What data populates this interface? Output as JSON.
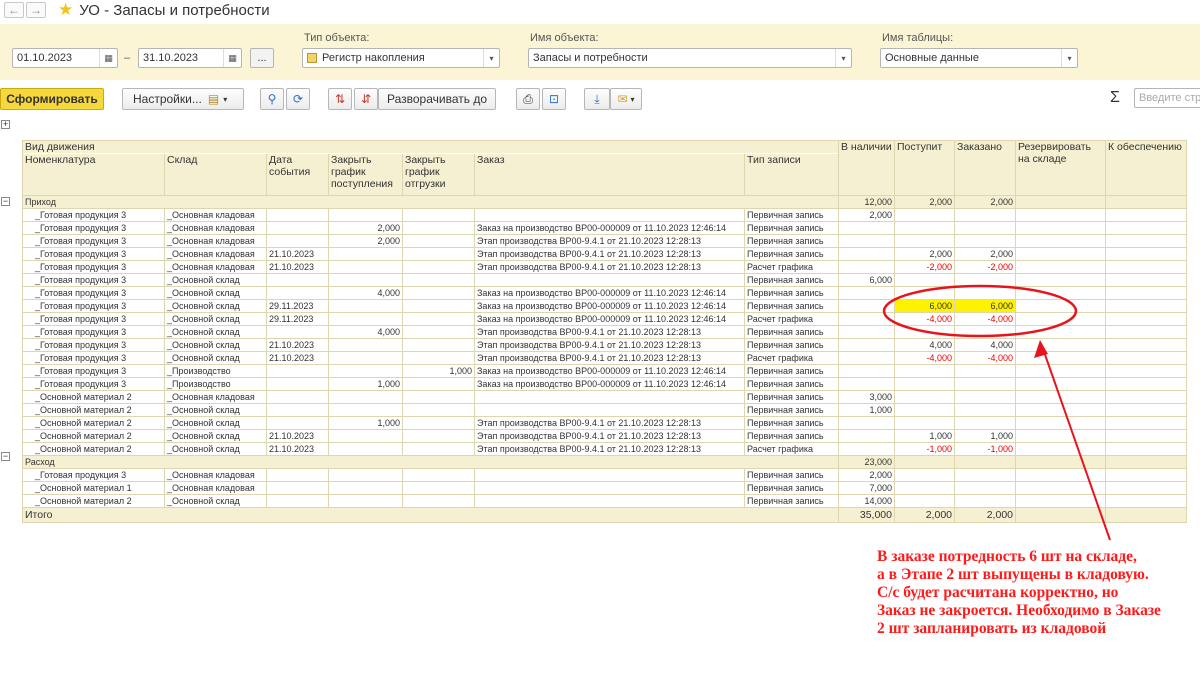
{
  "window": {
    "title": "УО - Запасы и потребности",
    "back_glyph": "←",
    "forward_glyph": "→",
    "favorite_glyph": "★"
  },
  "filters": {
    "date_from": "01.10.2023",
    "date_sep": "–",
    "date_to": "31.10.2023",
    "period_button": "...",
    "object_type_label": "Тип объекта:",
    "object_type_value": "Регистр накопления",
    "object_name_label": "Имя объекта:",
    "object_name_value": "Запасы и потребности",
    "table_name_label": "Имя таблицы:",
    "table_name_value": "Основные данные"
  },
  "toolbar": {
    "generate_label": "Сформировать",
    "settings_label": "Настройки...",
    "expand_label": "Разворачивать до",
    "sigma": "Σ",
    "search_placeholder": "Введите стр"
  },
  "icons": {
    "calendar": "calendar-icon",
    "dropdown": "chevron-down-icon",
    "search": "search-icon",
    "print": "printer-icon",
    "download": "download-icon",
    "mail": "mail-icon"
  },
  "colors": {
    "accent_yellow": "#f6d83b",
    "panel_bg": "#fbf5d6",
    "header_bg": "#f6f0d2",
    "negative": "#e00000",
    "highlight": "#fff200",
    "annotation": "#ff1a1a"
  },
  "grid": {
    "header_top": "Вид движения",
    "columns": [
      "Номенклатура",
      "Склад",
      "Дата события",
      "Закрыть график поступления",
      "Закрыть график отгрузки",
      "Заказ",
      "Тип записи",
      "В наличии",
      "Поступит",
      "Заказано",
      "Резервировать на складе",
      "К обеспечению"
    ],
    "groups": [
      {
        "name": "Приход",
        "totals": [
          "12,000",
          "2,000",
          "2,000",
          "",
          ""
        ],
        "rows": [
          [
            "_Готовая продукция 3",
            "_Основная кладовая",
            "",
            "",
            "",
            "",
            "Первичная запись",
            "2,000",
            "",
            "",
            "",
            ""
          ],
          [
            "_Готовая продукция 3",
            "_Основная кладовая",
            "",
            "2,000",
            "",
            "Заказ на производство ВР00-000009 от 11.10.2023 12:46:14",
            "Первичная запись",
            "",
            "",
            "",
            "",
            ""
          ],
          [
            "_Готовая продукция 3",
            "_Основная кладовая",
            "",
            "2,000",
            "",
            "Этап производства ВР00-9.4.1 от 21.10.2023 12:28:13",
            "Первичная запись",
            "",
            "",
            "",
            "",
            ""
          ],
          [
            "_Готовая продукция 3",
            "_Основная кладовая",
            "21.10.2023",
            "",
            "",
            "Этап производства ВР00-9.4.1 от 21.10.2023 12:28:13",
            "Первичная запись",
            "",
            "2,000",
            "2,000",
            "",
            ""
          ],
          [
            "_Готовая продукция 3",
            "_Основная кладовая",
            "21.10.2023",
            "",
            "",
            "Этап производства ВР00-9.4.1 от 21.10.2023 12:28:13",
            "Расчет графика",
            "",
            "-2,000",
            "-2,000",
            "",
            ""
          ],
          [
            "_Готовая продукция 3",
            "_Основной склад",
            "",
            "",
            "",
            "",
            "Первичная запись",
            "6,000",
            "",
            "",
            "",
            ""
          ],
          [
            "_Готовая продукция 3",
            "_Основной склад",
            "",
            "4,000",
            "",
            "Заказ на производство ВР00-000009 от 11.10.2023 12:46:14",
            "Первичная запись",
            "",
            "",
            "",
            "",
            ""
          ],
          [
            "_Готовая продукция 3",
            "_Основной склад",
            "29.11.2023",
            "",
            "",
            "Заказ на производство ВР00-000009 от 11.10.2023 12:46:14",
            "Первичная запись",
            "",
            "6,000",
            "6,000",
            "",
            ""
          ],
          [
            "_Готовая продукция 3",
            "_Основной склад",
            "29.11.2023",
            "",
            "",
            "Заказ на производство ВР00-000009 от 11.10.2023 12:46:14",
            "Расчет графика",
            "",
            "-4,000",
            "-4,000",
            "",
            ""
          ],
          [
            "_Готовая продукция 3",
            "_Основной склад",
            "",
            "4,000",
            "",
            "Этап производства ВР00-9.4.1 от 21.10.2023 12:28:13",
            "Первичная запись",
            "",
            "",
            "",
            "",
            ""
          ],
          [
            "_Готовая продукция 3",
            "_Основной склад",
            "21.10.2023",
            "",
            "",
            "Этап производства ВР00-9.4.1 от 21.10.2023 12:28:13",
            "Первичная запись",
            "",
            "4,000",
            "4,000",
            "",
            ""
          ],
          [
            "_Готовая продукция 3",
            "_Основной склад",
            "21.10.2023",
            "",
            "",
            "Этап производства ВР00-9.4.1 от 21.10.2023 12:28:13",
            "Расчет графика",
            "",
            "-4,000",
            "-4,000",
            "",
            ""
          ],
          [
            "_Готовая продукция 3",
            "_Производство",
            "",
            "",
            "1,000",
            "Заказ на производство ВР00-000009 от 11.10.2023 12:46:14",
            "Первичная запись",
            "",
            "",
            "",
            "",
            ""
          ],
          [
            "_Готовая продукция 3",
            "_Производство",
            "",
            "1,000",
            "",
            "Заказ на производство ВР00-000009 от 11.10.2023 12:46:14",
            "Первичная запись",
            "",
            "",
            "",
            "",
            ""
          ],
          [
            "_Основной материал 2",
            "_Основная кладовая",
            "",
            "",
            "",
            "",
            "Первичная запись",
            "3,000",
            "",
            "",
            "",
            ""
          ],
          [
            "_Основной материал 2",
            "_Основной склад",
            "",
            "",
            "",
            "",
            "Первичная запись",
            "1,000",
            "",
            "",
            "",
            ""
          ],
          [
            "_Основной материал 2",
            "_Основной склад",
            "",
            "1,000",
            "",
            "Этап производства ВР00-9.4.1 от 21.10.2023 12:28:13",
            "Первичная запись",
            "",
            "",
            "",
            "",
            ""
          ],
          [
            "_Основной материал 2",
            "_Основной склад",
            "21.10.2023",
            "",
            "",
            "Этап производства ВР00-9.4.1 от 21.10.2023 12:28:13",
            "Первичная запись",
            "",
            "1,000",
            "1,000",
            "",
            ""
          ],
          [
            "_Основной материал 2",
            "_Основной склад",
            "21.10.2023",
            "",
            "",
            "Этап производства ВР00-9.4.1 от 21.10.2023 12:28:13",
            "Расчет графика",
            "",
            "-1,000",
            "-1,000",
            "",
            ""
          ]
        ]
      },
      {
        "name": "Расход",
        "totals": [
          "23,000",
          "",
          "",
          "",
          ""
        ],
        "rows": [
          [
            "_Готовая продукция 3",
            "_Основная кладовая",
            "",
            "",
            "",
            "",
            "Первичная запись",
            "2,000",
            "",
            "",
            "",
            ""
          ],
          [
            "_Основной материал 1",
            "_Основная кладовая",
            "",
            "",
            "",
            "",
            "Первичная запись",
            "7,000",
            "",
            "",
            "",
            ""
          ],
          [
            "_Основной материал 2",
            "_Основной склад",
            "",
            "",
            "",
            "",
            "Первичная запись",
            "14,000",
            "",
            "",
            "",
            ""
          ]
        ]
      }
    ],
    "total_label": "Итого",
    "grand_totals": [
      "35,000",
      "2,000",
      "2,000",
      "",
      ""
    ]
  },
  "annotation": {
    "lines": [
      "В заказе потредность 6 шт на складе,",
      "а в Этапе 2 шт выпущены в кладовую.",
      "С/с будет расчитана корректно, но",
      "Заказ не закроется. Необходимо в Заказе",
      "2 шт запланировать из кладовой"
    ]
  }
}
